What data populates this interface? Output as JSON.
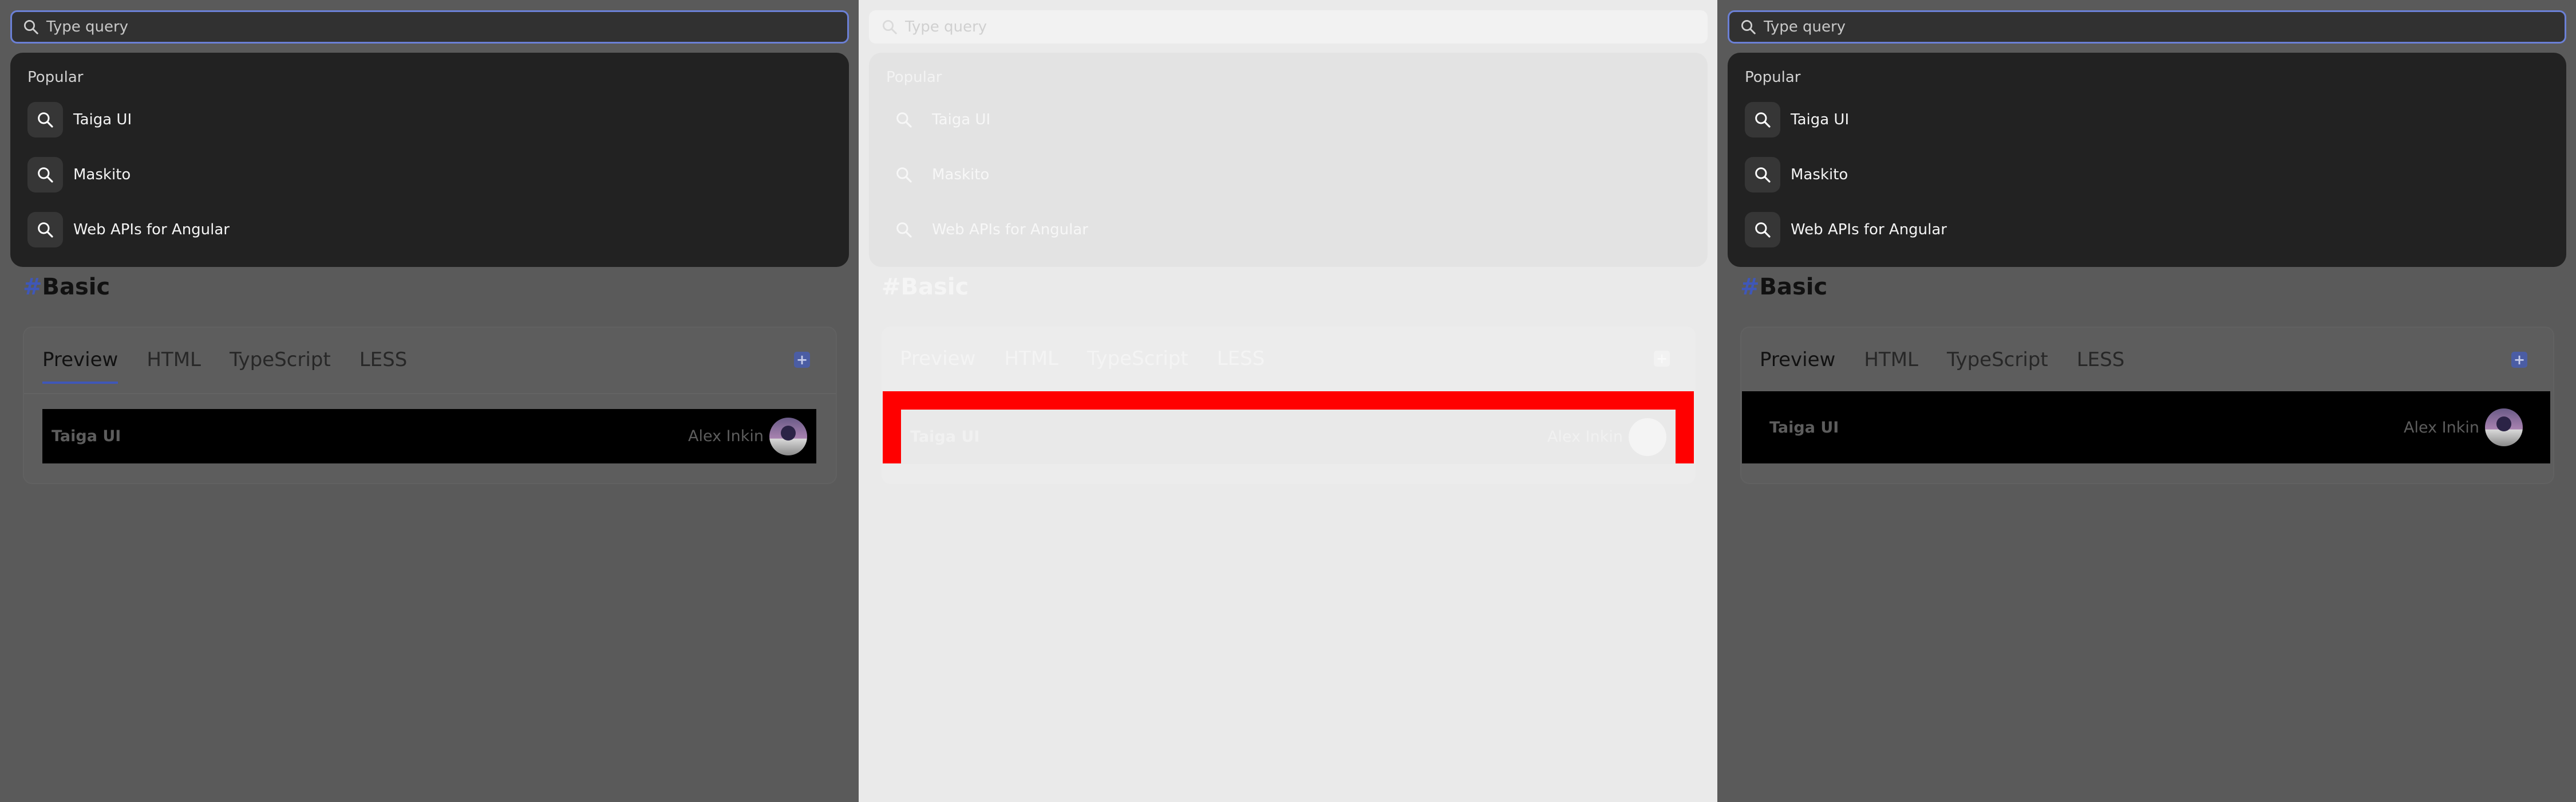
{
  "search": {
    "placeholder": "Type query"
  },
  "dropdown": {
    "title": "Popular",
    "items": [
      {
        "label": "Taiga UI",
        "icon": "search-icon"
      },
      {
        "label": "Maskito",
        "icon": "search-icon"
      },
      {
        "label": "Web APIs for Angular",
        "icon": "search-icon"
      }
    ]
  },
  "section": {
    "hash": "#",
    "title": "Basic"
  },
  "tabs": [
    "Preview",
    "HTML",
    "TypeScript",
    "LESS"
  ],
  "preview": {
    "brand": "Taiga UI",
    "user": "Alex Inkin"
  },
  "colors": {
    "accent": "#3f57b8",
    "focus_border": "#6b80d6",
    "highlight": "#ff0000",
    "dropdown_bg": "#222222",
    "backdrop": "#5a5a5a"
  }
}
